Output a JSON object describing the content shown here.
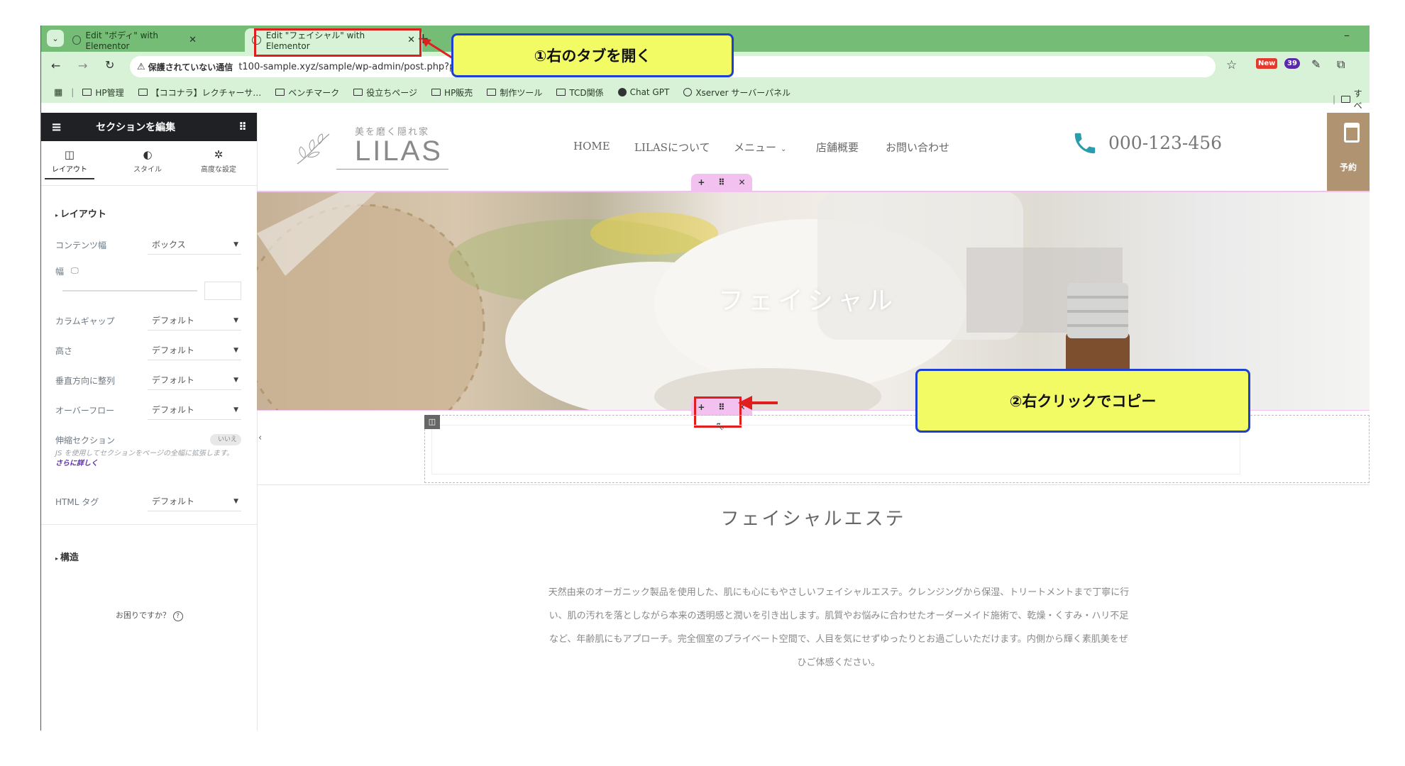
{
  "browser": {
    "tabs": [
      {
        "title": "Edit \"ボディ\" with Elementor",
        "active": false
      },
      {
        "title": "Edit \"フェイシャル\" with Elementor",
        "active": true
      }
    ],
    "security_label": "保護されていない通信",
    "url": "t100-sample.xyz/sample/wp-admin/post.php?p",
    "bookmarks": [
      "HP管理",
      "【ココナラ】レクチャーサ…",
      "ベンチマーク",
      "役立ちページ",
      "HP販売",
      "制作ツール",
      "TCD関係",
      "Chat GPT",
      "Xserver サーバーパネル"
    ],
    "bookmarks_right": "すべ",
    "new_badge": "New",
    "ext_count": "39"
  },
  "panel": {
    "title": "セクションを編集",
    "tabs": [
      "レイアウト",
      "スタイル",
      "高度な設定"
    ],
    "section_layout": "レイアウト",
    "rows": [
      {
        "label": "コンテンツ幅",
        "value": "ボックス"
      },
      {
        "label": "カラムギャップ",
        "value": "デフォルト"
      },
      {
        "label": "高さ",
        "value": "デフォルト"
      },
      {
        "label": "垂直方向に整列",
        "value": "デフォルト"
      },
      {
        "label": "オーバーフロー",
        "value": "デフォルト"
      }
    ],
    "width_label": "幅",
    "stretch_label": "伸縮セクション",
    "stretch_toggle": "いいえ",
    "stretch_help": "JS を使用してセクションをページの全幅に拡張します。",
    "stretch_link": "さらに詳しく",
    "html_tag_label": "HTML タグ",
    "html_tag_value": "デフォルト",
    "section_structure": "構造",
    "help": "お困りですか？"
  },
  "site": {
    "logo_tagline": "美を磨く隠れ家",
    "logo_name": "LILAS",
    "nav": [
      "HOME",
      "LILASについて",
      "メニュー",
      "店舗概要",
      "お問い合わせ"
    ],
    "phone": "000-123-456",
    "reserve": "予約",
    "hero_title": "フェイシャル",
    "section_heading": "フェイシャルエステ",
    "body_lines": [
      "天然由来のオーガニック製品を使用した、肌にも心にもやさしいフェイシャルエステ。クレンジングから保湿、トリートメントまで丁寧に行",
      "い、肌の汚れを落としながら本来の透明感と潤いを引き出します。肌質やお悩みに合わせたオーダーメイド施術で、乾燥・くすみ・ハリ不足",
      "など、年齢肌にもアプローチ。完全個室のプライベート空間で、人目を気にせずゆったりとお過ごしいただけます。内側から輝く素肌美をぜ",
      "ひご体感ください。"
    ]
  },
  "annotations": {
    "step1": "①右のタブを開く",
    "step2": "②右クリックでコピー"
  },
  "colors": {
    "tabbar": "#75bc76",
    "toolbar": "#d7f2d6",
    "annotation_fill": "#f2fb64",
    "annotation_border": "#1f3fcf",
    "highlight_red": "#e01e1e",
    "elementor_pink": "#f3c1f0",
    "phone_teal": "#2b9cab",
    "reserve_brown": "#b09370"
  }
}
